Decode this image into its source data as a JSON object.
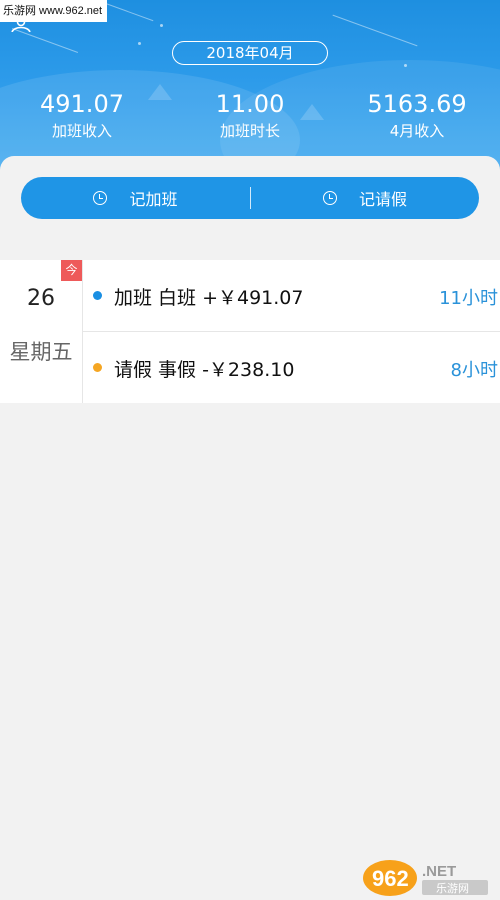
{
  "watermark": {
    "text": "乐游网 www.962.net"
  },
  "header": {
    "month": "2018年04月",
    "stats": [
      {
        "value": "491.07",
        "label": "加班收入"
      },
      {
        "value": "11.00",
        "label": "加班时长"
      },
      {
        "value": "5163.69",
        "label": "4月收入"
      }
    ]
  },
  "actions": {
    "overtime_label": "记加班",
    "leave_label": "记请假"
  },
  "record": {
    "today_badge": "今",
    "day": "26",
    "weekday": "星期五",
    "entries": [
      {
        "text": "加班  白班  +￥491.07",
        "hours": "11小时",
        "color": "#1a8fe3"
      },
      {
        "text": "请假  事假  -￥238.10",
        "hours": "8小时",
        "color": "#f5a623"
      }
    ]
  },
  "logo": {
    "number": "962",
    "suffix": ".NET",
    "caption": "乐游网"
  },
  "colors": {
    "accent": "#1f95e6",
    "today": "#ee5a5a",
    "leave": "#f5a623",
    "hours": "#2a92d9"
  }
}
